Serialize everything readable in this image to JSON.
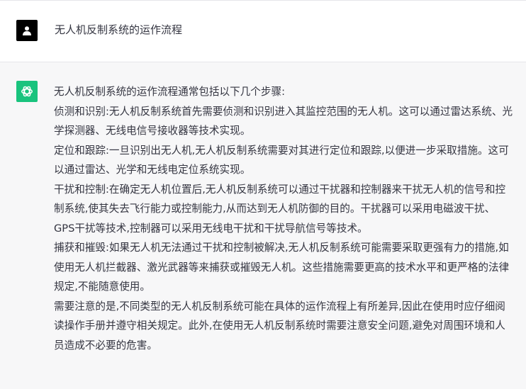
{
  "user_message": {
    "text": "无人机反制系统的运作流程"
  },
  "assistant_message": {
    "intro": "无人机反制系统的运作流程通常包括以下几个步骤:",
    "steps": [
      "侦测和识别:无人机反制系统首先需要侦测和识别进入其监控范围的无人机。这可以通过雷达系统、光学探测器、无线电信号接收器等技术实现。",
      "定位和跟踪:一旦识别出无人机,无人机反制系统需要对其进行定位和跟踪,以便进一步采取措施。这可以通过雷达、光学和无线电定位系统实现。",
      "干扰和控制:在确定无人机位置后,无人机反制系统可以通过干扰器和控制器来干扰无人机的信号和控制系统,使其失去飞行能力或控制能力,从而达到无人机防御的目的。干扰器可以采用电磁波干扰、GPS干扰等技术,控制器可以采用无线电干扰和干扰导航信号等技术。",
      "捕获和摧毁:如果无人机无法通过干扰和控制被解决,无人机反制系统可能需要采取更强有力的措施,如使用无人机拦截器、激光武器等来捕获或摧毁无人机。这些措施需要更高的技术水平和更严格的法律规定,不能随意使用。"
    ],
    "closing": "需要注意的是,不同类型的无人机反制系统可能在具体的运作流程上有所差异,因此在使用时应仔细阅读操作手册并遵守相关规定。此外,在使用无人机反制系统时需要注意安全问题,避免对周围环境和人员造成不必要的危害。"
  },
  "colors": {
    "user_avatar": "#000000",
    "assistant_avatar": "#19c37d",
    "assistant_bg": "#f7f7f8",
    "text": "#343541"
  },
  "icons": {
    "user_avatar": "user-silhouette-icon",
    "assistant_avatar": "openai-logo-icon"
  }
}
